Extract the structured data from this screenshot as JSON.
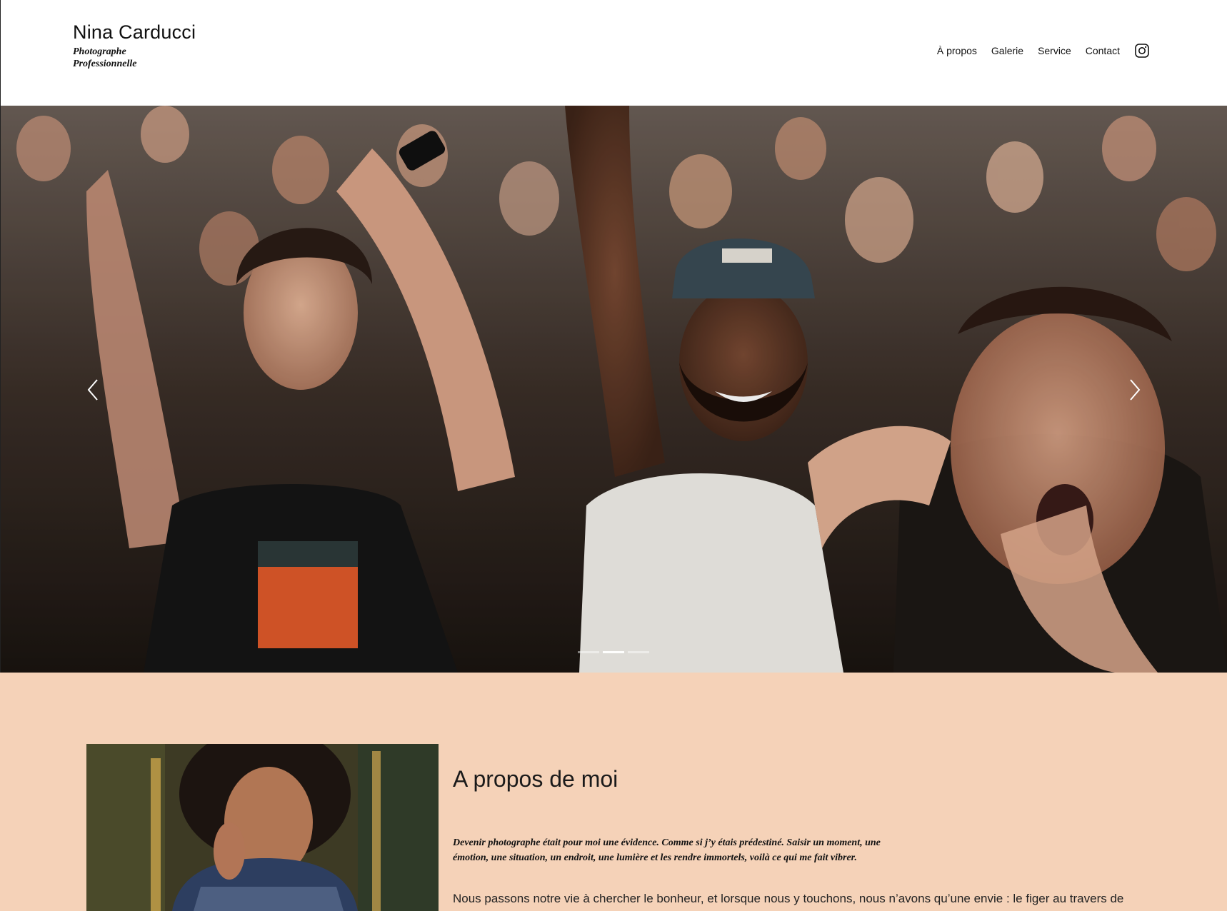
{
  "brand": {
    "name": "Nina Carducci",
    "tagline": "Photographe Professionnelle"
  },
  "nav": {
    "items": [
      "À propos",
      "Galerie",
      "Service",
      "Contact"
    ],
    "instagram_icon": "instagram-icon"
  },
  "carousel": {
    "slide_count": 3,
    "active_index": 1,
    "prev_icon": "chevron-left-icon",
    "next_icon": "chevron-right-icon"
  },
  "about": {
    "title": "A propos de moi",
    "quote": "Devenir photographe était pour moi une évidence. Comme si j’y étais prédestiné. Saisir un moment, une émotion, une situation, un endroit, une lumière et les rendre immortels, voilà ce qui me fait vibrer.",
    "body": "Nous passons notre vie à chercher le bonheur, et lorsque nous y touchons, nous n’avons qu’une envie : le figer au travers de"
  },
  "colors": {
    "about_background": "#f5d2b8",
    "text": "#111111"
  }
}
